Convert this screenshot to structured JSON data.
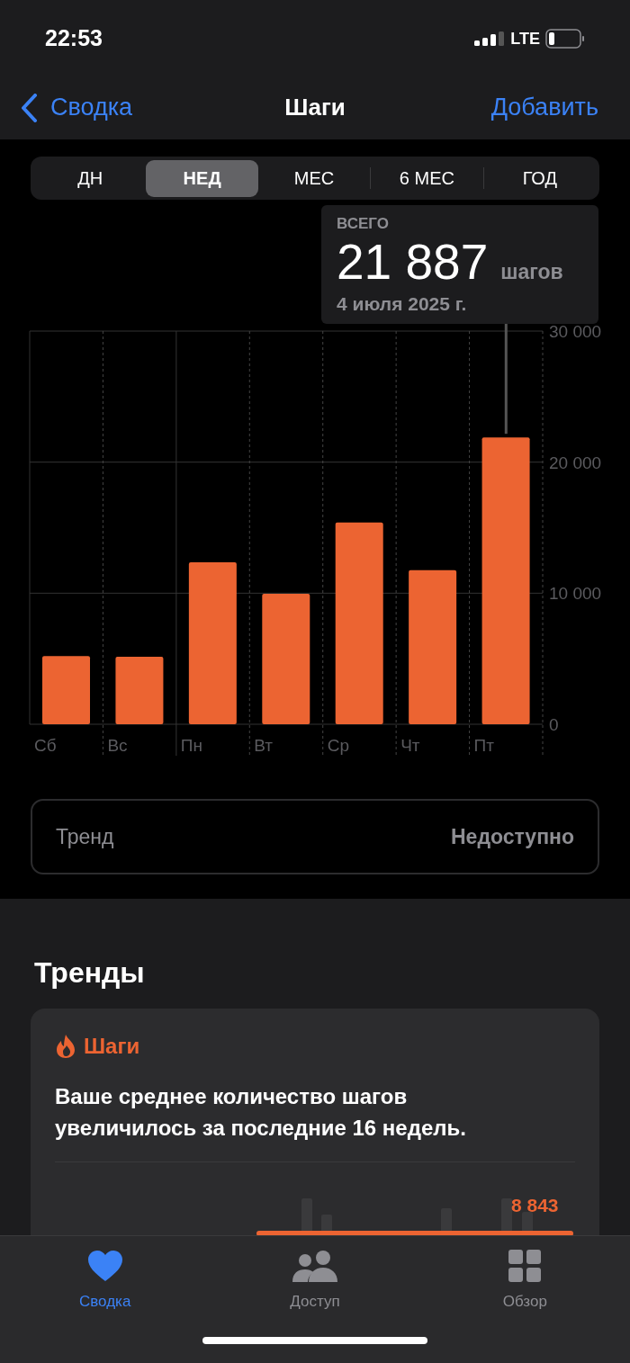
{
  "status_bar": {
    "time": "22:53",
    "network": "LTE"
  },
  "nav": {
    "back": "Сводка",
    "title": "Шаги",
    "action": "Добавить"
  },
  "segments": [
    {
      "label": "ДН",
      "selected": false
    },
    {
      "label": "НЕД",
      "selected": true
    },
    {
      "label": "МЕС",
      "selected": false
    },
    {
      "label": "6 МЕС",
      "selected": false
    },
    {
      "label": "ГОД",
      "selected": false
    }
  ],
  "summary": {
    "label": "ВСЕГО",
    "value": "21 887",
    "unit": "шагов",
    "date": "4 июля 2025 г."
  },
  "chart_data": {
    "type": "bar",
    "categories": [
      "Сб",
      "Вс",
      "Пн",
      "Вт",
      "Ср",
      "Чт",
      "Пт"
    ],
    "series": [
      {
        "color": "#ec6432",
        "values": [
          5200,
          5150,
          12350,
          9950,
          15400,
          11750,
          21887
        ]
      }
    ],
    "ylim": [
      0,
      30000
    ],
    "yticks": [
      {
        "value": 0,
        "label": "0"
      },
      {
        "value": 10000,
        "label": "10 000"
      },
      {
        "value": 20000,
        "label": "20 000"
      },
      {
        "value": 30000,
        "label": "30 000"
      }
    ]
  },
  "trend_row": {
    "label": "Тренд",
    "value": "Недоступно"
  },
  "trends": {
    "title": "Тренды",
    "card": {
      "category": "Шаги",
      "text": "Ваше среднее количество шагов увеличилось за последние 16 недель.",
      "value": "8 843"
    }
  },
  "tab_bar": [
    {
      "label": "Сводка",
      "kind": "summary",
      "selected": true
    },
    {
      "label": "Доступ",
      "kind": "sharing",
      "selected": false
    },
    {
      "label": "Обзор",
      "kind": "browse",
      "selected": false
    }
  ]
}
